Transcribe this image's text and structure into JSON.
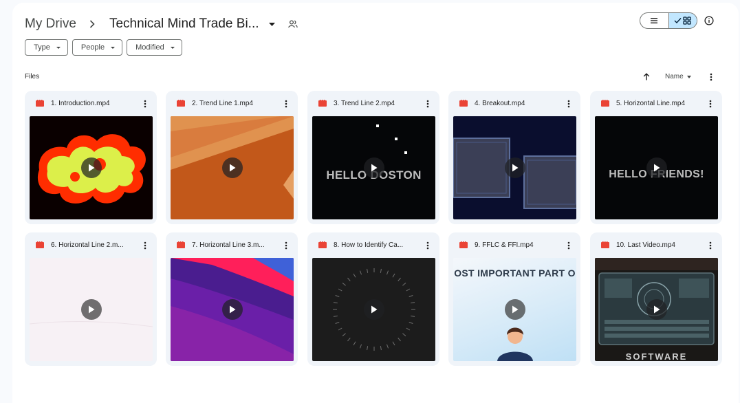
{
  "breadcrumb": {
    "root": "My Drive",
    "current": "Technical Mind Trade Bi..."
  },
  "filters": [
    {
      "label": "Type"
    },
    {
      "label": "People"
    },
    {
      "label": "Modified"
    }
  ],
  "section": {
    "files_label": "Files",
    "sort_label": "Name"
  },
  "colors": {
    "accent": "#c2e7ff",
    "video_icon": "#ea4335",
    "card_bg": "#f0f4f9"
  },
  "files": [
    {
      "name": "1. Introduction.mp4"
    },
    {
      "name": "2. Trend Line 1.mp4"
    },
    {
      "name": "3. Trend Line 2.mp4",
      "thumb_text": "HELLO DOSTON"
    },
    {
      "name": "4. Breakout.mp4"
    },
    {
      "name": "5. Horizontal Line.mp4",
      "thumb_text": "HELLO FRIENDS!"
    },
    {
      "name": "6. Horizontal Line 2.m..."
    },
    {
      "name": "7. Horizontal Line 3.m..."
    },
    {
      "name": "8. How to Identify Ca..."
    },
    {
      "name": "9. FFLC & FFI.mp4",
      "thumb_text": "OST IMPORTANT PART O"
    },
    {
      "name": "10. Last Video.mp4",
      "thumb_text": "SOFTWARE"
    }
  ]
}
